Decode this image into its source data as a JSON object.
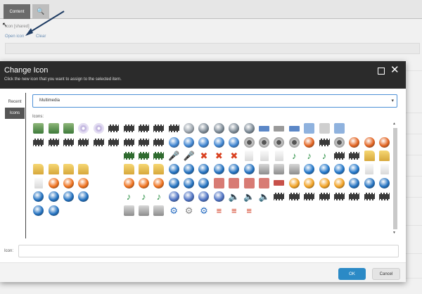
{
  "background": {
    "tabs": [
      {
        "label": "Content"
      },
      {
        "label": "🔍",
        "icon": "search-icon"
      }
    ],
    "field_label": "Icon [shared]",
    "links": {
      "open_icon": "Open icon",
      "clear": "Clear"
    }
  },
  "dialog": {
    "title": "Change Icon",
    "subtitle": "Click the new icon that you want to assign to the selected item.",
    "tabs": {
      "recent": "Recent",
      "icons": "Icons"
    },
    "category_select": {
      "value": "Multimedia"
    },
    "icons_label": "Icons:",
    "icon_field_label": "Icon:",
    "icon_field_value": "",
    "buttons": {
      "ok": "OK",
      "cancel": "Cancel"
    }
  },
  "icons": [
    "video-add",
    "video-remove",
    "video-add",
    "cd",
    "cd",
    "film-close",
    "film",
    "film-close",
    "film",
    "film-close",
    "navigation-button",
    "eject-button",
    "eject-button",
    "eject-button",
    "eject-button",
    "bars-blue",
    "bars",
    "bars-blue",
    "grid-blue",
    "grid",
    "grid-blue",
    "",
    "",
    "",
    "film-dark",
    "film",
    "film-film",
    "film",
    "film",
    "film-arrow",
    "film",
    "film-arrow",
    "film",
    "forward-button",
    "forward-button",
    "forward-button",
    "forward-button",
    "forward-button",
    "film-reel",
    "film-reel",
    "film-reel",
    "film-reel",
    "first-button",
    "film-box",
    "film-reel-red",
    "first-button",
    "first-button",
    "first-button",
    "",
    "",
    "",
    "",
    "",
    "",
    "film-green",
    "film-green",
    "film-green",
    "microphone",
    "microphone",
    "film-delete",
    "film-delete",
    "film-delete",
    "document",
    "document",
    "document",
    "music-note",
    "music-note",
    "music-note",
    "film-strip",
    "film-strip",
    "folder",
    "folder",
    "folder",
    "folder",
    "folder",
    "folder",
    "",
    "",
    "folder-film",
    "folder-film",
    "folder-film",
    "pause-button",
    "pause-button",
    "pause-button",
    "pause-button",
    "pause-button",
    "pause-button",
    "projector",
    "projector",
    "projector",
    "play-button",
    "play-button",
    "play-button",
    "play-button",
    "play-list",
    "play-list",
    "play-list",
    "record-button",
    "record-button",
    "record-button",
    "",
    "",
    "record-button",
    "record-button",
    "record-button",
    "stop-button",
    "stop-button",
    "stop-button",
    "grid-red",
    "grid-red",
    "grid-red",
    "grid-red",
    "bars-red",
    "repeat-button",
    "repeat-button",
    "repeat-button",
    "repeat-button",
    "stop-button",
    "stop-button",
    "stop-button",
    "stop-button",
    "stop-button",
    "stop-button",
    "stop-button",
    "",
    "",
    "music-note",
    "music-note",
    "music-note",
    "rewind-button",
    "rewind-button",
    "rewind-button",
    "rewind-button",
    "speaker",
    "speaker",
    "speaker",
    "film-music",
    "film-music",
    "film-music",
    "film-music",
    "film-music",
    "film-music",
    "film-music",
    "film-music",
    "stop-button",
    "stop-button",
    "",
    "",
    "",
    "",
    "disk-camera",
    "disk-camera",
    "disk-camera",
    "cog-blue",
    "cog",
    "cog-blue",
    "equalizer",
    "equalizer",
    "equalizer",
    "",
    "",
    "",
    "",
    "",
    "",
    "",
    "",
    "",
    "",
    "",
    "",
    "",
    "",
    ""
  ]
}
